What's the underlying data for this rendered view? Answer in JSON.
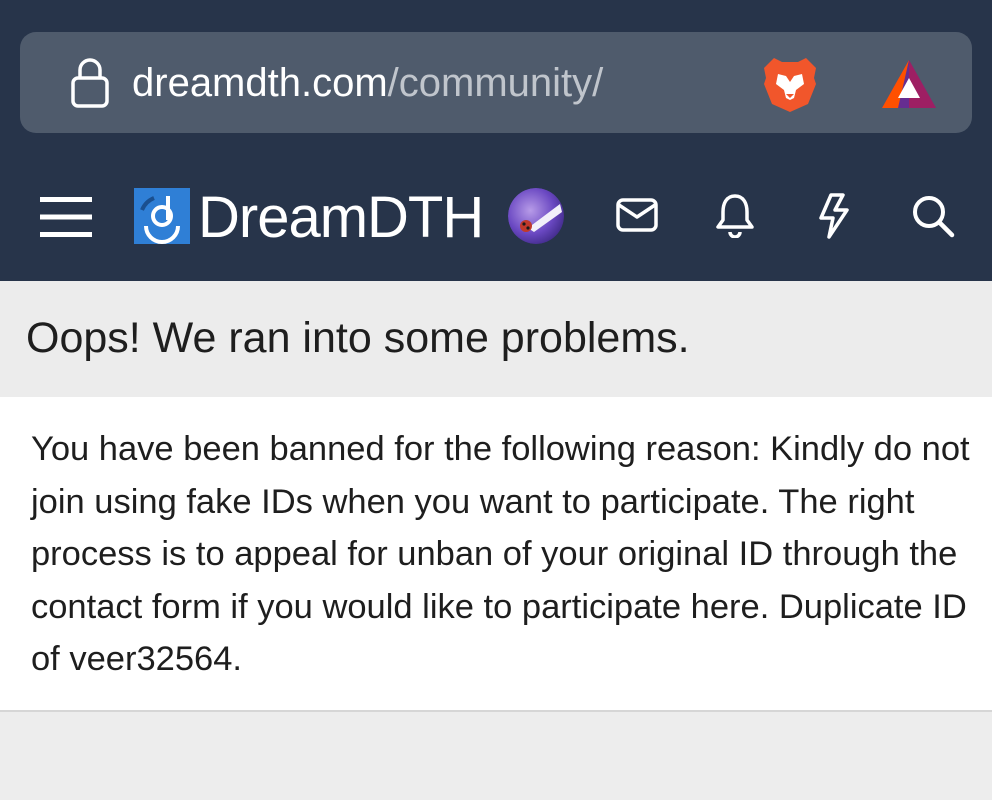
{
  "browser": {
    "url_host": "dreamdth.com",
    "url_path": "/community/",
    "icons": [
      "lock-icon",
      "brave-lion-icon",
      "bat-rewards-icon"
    ]
  },
  "header": {
    "site_name": "DreamDTH",
    "icons": [
      "menu-icon",
      "logo-icon",
      "avatar",
      "mail-icon",
      "bell-icon",
      "bolt-icon",
      "search-icon"
    ]
  },
  "error": {
    "title": "Oops! We ran into some problems.",
    "message": "You have been banned for the following reason: Kindly do not join using fake IDs when you want to participate. The right process is to appeal for unban of your original ID through the contact form if you would like to participate here. Duplicate ID of veer32564."
  },
  "colors": {
    "header_bg": "#27344a",
    "url_bar_bg": "#4f5b6c",
    "logo_blue": "#2f7fd6",
    "page_bg": "#ededed"
  }
}
